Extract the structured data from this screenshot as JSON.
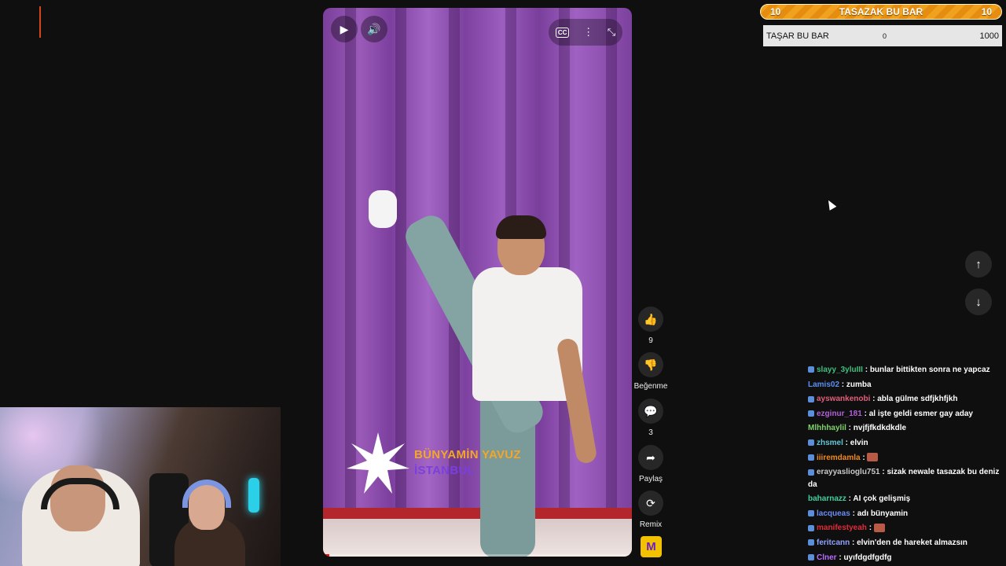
{
  "player": {
    "caption_name": "BÜNYAMİN YAVUZ",
    "caption_city": "İSTANBUL",
    "progress_fraction": 0.02
  },
  "actions": {
    "like_count": "9",
    "dislike_label": "Beğenme",
    "comments_count": "3",
    "share_label": "Paylaş",
    "remix_label": "Remix",
    "channel_badge": "M"
  },
  "overlay": {
    "left_value": "10",
    "title": "TASAZAK BU BAR",
    "right_value": "10",
    "box_label": "TAŞAR BU BAR",
    "box_min": "0",
    "box_max": "1000"
  },
  "chat": [
    {
      "user": "slayy_3yluIII",
      "text": ": bunlar bittikten sonra ne yapcaz",
      "color": "#3fbf7f",
      "badge": true
    },
    {
      "user": "Lamis02",
      "text": ": zumba",
      "color": "#5b8ff0",
      "badge": false
    },
    {
      "user": "ayswankenobi",
      "text": ": abla gülme sdfjkhfjkh",
      "color": "#e0607a",
      "badge": true
    },
    {
      "user": "ezginur_181",
      "text": ": al işte geldi esmer gay aday",
      "color": "#b35fd9",
      "badge": true
    },
    {
      "user": "Mlhhhaylil",
      "text": ": nvjfjfkdkdkdle",
      "color": "#7fd36b",
      "badge": false
    },
    {
      "user": "zhsmel",
      "text": ": elvin",
      "color": "#62c6d6",
      "badge": true
    },
    {
      "user": "iiiremdamla",
      "text": ":",
      "color": "#f08a1c",
      "badge": true,
      "emote": true
    },
    {
      "user": "erayyaslioglu751",
      "text": ": sizak newale tasazak bu deniz da",
      "color": "#c9c9c9",
      "badge": true,
      "wrap": true
    },
    {
      "user": "baharnazz",
      "text": ": AI çok gelişmiş",
      "color": "#3fd0a0",
      "badge": false
    },
    {
      "user": "lacqueas",
      "text": ": adı bünyamin",
      "color": "#6a8cf5",
      "badge": true
    },
    {
      "user": "manifestyeah",
      "text": ":",
      "color": "#e02b3a",
      "badge": true,
      "emote": true
    },
    {
      "user": "feritcann",
      "text": ": elvin'den de hareket almazsın",
      "color": "#8fa3ff",
      "badge": true
    },
    {
      "user": "Clner",
      "text": ": uyıfdgdfgdfg",
      "color": "#b86bff",
      "badge": true
    }
  ]
}
